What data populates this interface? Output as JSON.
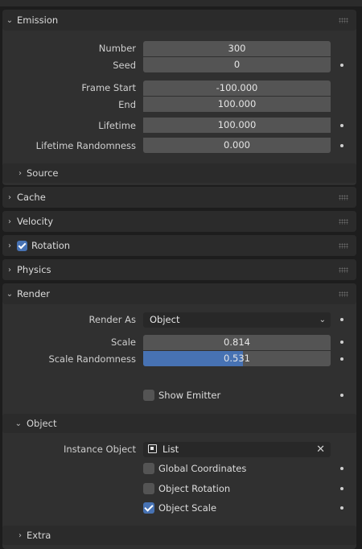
{
  "emission": {
    "title": "Emission",
    "number_label": "Number",
    "number_value": "300",
    "seed_label": "Seed",
    "seed_value": "0",
    "frame_start_label": "Frame Start",
    "frame_start_value": "-100.000",
    "end_label": "End",
    "end_value": "100.000",
    "lifetime_label": "Lifetime",
    "lifetime_value": "100.000",
    "lifetime_rand_label": "Lifetime Randomness",
    "lifetime_rand_value": "0.000",
    "source_label": "Source"
  },
  "panels": {
    "cache": "Cache",
    "velocity": "Velocity",
    "rotation": "Rotation",
    "physics": "Physics"
  },
  "render": {
    "title": "Render",
    "render_as_label": "Render As",
    "render_as_value": "Object",
    "scale_label": "Scale",
    "scale_value": "0.814",
    "scale_rand_label": "Scale Randomness",
    "scale_rand_value": "0.531",
    "scale_rand_fraction": 0.531,
    "show_emitter_label": "Show Emitter",
    "show_emitter_checked": false,
    "object_sub_label": "Object",
    "instance_object_label": "Instance Object",
    "instance_object_value": "List",
    "global_coords_label": "Global Coordinates",
    "global_coords_checked": false,
    "object_rotation_label": "Object Rotation",
    "object_rotation_checked": false,
    "object_scale_label": "Object Scale",
    "object_scale_checked": true,
    "extra_label": "Extra"
  },
  "colors": {
    "accent": "#4772b3",
    "field": "#545454",
    "panel": "#303030"
  }
}
